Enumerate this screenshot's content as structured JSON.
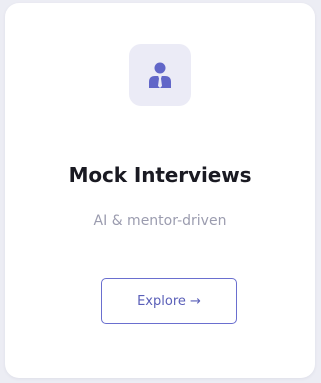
{
  "card": {
    "icon": "user-tie-icon",
    "title": "Mock Interviews",
    "subtitle": "AI & mentor-driven",
    "button_label": "Explore →"
  },
  "colors": {
    "page_background": "#ecedf4",
    "card_background": "#ffffff",
    "icon_tile": "#ebebf6",
    "icon": "#6166c8",
    "title": "#1a1a22",
    "subtitle": "#9b9caf",
    "button_border": "#6a6fcf",
    "button_text": "#5a5fb8"
  }
}
